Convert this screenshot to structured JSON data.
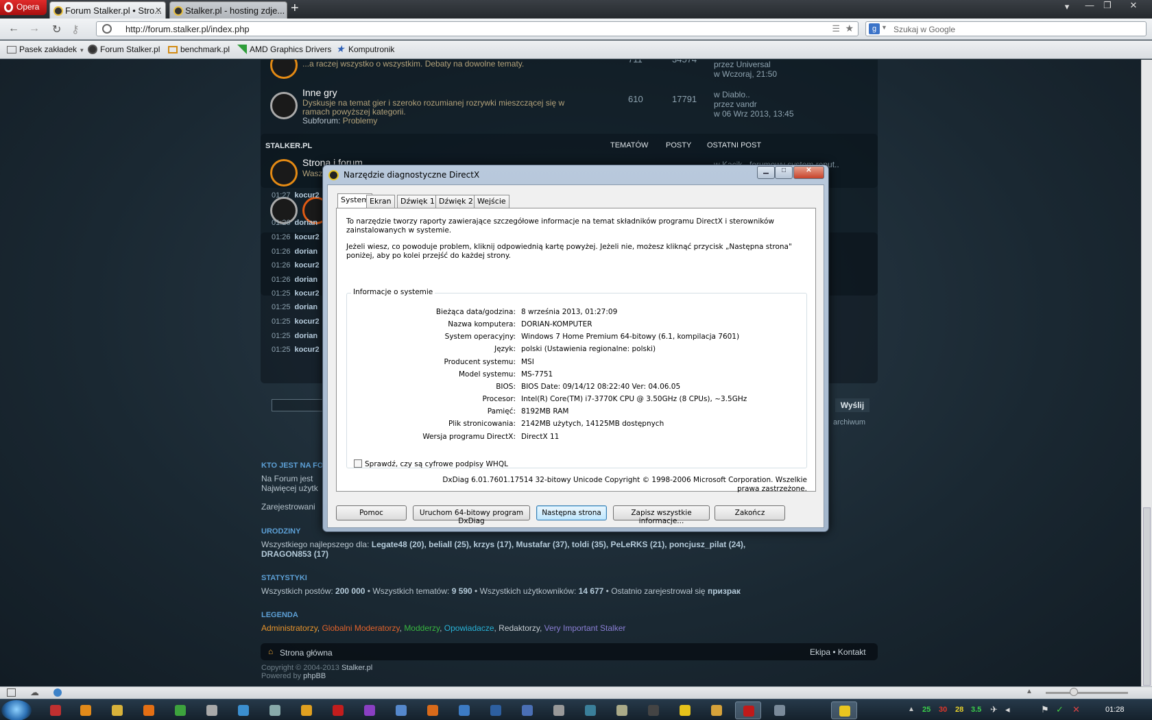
{
  "browser": {
    "menu_label": "Opera",
    "tabs": [
      {
        "label": "Forum Stalker.pl • Stro..."
      },
      {
        "label": "Stalker.pl - hosting zdje..."
      }
    ],
    "url": "http://forum.stalker.pl/index.php",
    "search_placeholder": "Szukaj w Google",
    "bookmarks": [
      "Pasek zakładek",
      "Forum Stalker.pl",
      "benchmark.pl",
      "AMD Graphics Drivers",
      "Komputronik"
    ]
  },
  "forum": {
    "row1": {
      "desc": "...a raczej wszystko o wszystkim. Debaty na dowolne tematy.",
      "topics": "711",
      "posts": "34574",
      "last_by": "przez Universal",
      "last_date": "w Wczoraj, 21:50"
    },
    "row2": {
      "title": "Inne gry",
      "desc1": "Dyskusje na temat gier i szeroko rozumianej rozrywki mieszczącej się w",
      "desc2": "ramach powyższej kategorii.",
      "sub_label": "Subforum:",
      "sub_item": "Problemy",
      "topics": "610",
      "posts": "17791",
      "last_in": "w Diablo..",
      "last_by": "przez vandr",
      "last_date": "w 06 Wrz 2013, 13:45"
    },
    "cat_header": {
      "name": "STALKER.PL",
      "col_topics": "TEMATÓW",
      "col_posts": "POSTY",
      "col_last": "OSTATNI POST"
    },
    "row3": {
      "title": "Strona i forum",
      "desc": "Wasz",
      "last": "w Kącik - forumowy system reput.."
    },
    "shoutbox": {
      "times": [
        "01:27",
        "01:26",
        "01:26",
        "01:26",
        "01:26",
        "01:26",
        "01:25",
        "01:25",
        "01:25",
        "01:25",
        "01:25"
      ],
      "users": [
        "kocur2",
        "dorian",
        "kocur2",
        "dorian",
        "kocur2",
        "dorian",
        "kocur2",
        "dorian",
        "kocur2",
        "dorian",
        "kocur2"
      ],
      "send_label": "Wyślij",
      "archive_label": "archiwum"
    },
    "who_header": "KTO JEST NA FO",
    "who_line1": "Na Forum jest",
    "who_line2": "Najwięcej użytk",
    "who_line3": "Zarejestrowani",
    "birthdays_header": "URODZINY",
    "birthdays_prefix": "Wszystkiego najlepszego dla:",
    "birthdays_line1": "Legate48 (20), beliall (25), krzys (17), Mustafar (37), toldi (35), PeLeRKS (21), poncjusz_pilat (24),",
    "birthdays_line2": "DRAGON853 (17)",
    "stats_header": "STATYSTYKI",
    "stats": {
      "posts_label": "Wszystkich postów:",
      "posts": "200 000",
      "topics_label": "Wszystkich tematów:",
      "topics": "9 590",
      "users_label": "Wszystkich użytkowników:",
      "users": "14 677",
      "newest_label": "Ostatnio zarejestrował się",
      "newest": "призрак"
    },
    "legend_header": "LEGENDA",
    "legend": [
      {
        "label": "Administratorzy",
        "color": "#e8942b"
      },
      {
        "label": "Globalni Moderatorzy",
        "color": "#e3632b"
      },
      {
        "label": "Modderzy",
        "color": "#38b640"
      },
      {
        "label": "Opowiadacze",
        "color": "#29b2d6"
      },
      {
        "label": "Redaktorzy",
        "color": "#c7cdd2"
      },
      {
        "label": "Very Important Stalker",
        "color": "#8b7fd6"
      }
    ],
    "footer": {
      "home": "Strona główna",
      "team": "Ekipa",
      "contact": "Kontakt",
      "copyright": "Copyright © 2004-2013",
      "copyright_site": "Stalker.pl",
      "powered": "Powered by",
      "powered_by": "phpBB"
    }
  },
  "dialog": {
    "title": "Narzędzie diagnostyczne DirectX",
    "tabs": [
      "System",
      "Ekran",
      "Dźwięk 1",
      "Dźwięk 2",
      "Wejście"
    ],
    "intro1": "To narzędzie tworzy raporty zawierające szczegółowe informacje na temat składników programu DirectX i sterowników zainstalowanych w systemie.",
    "intro2": "Jeżeli wiesz, co powoduje problem, kliknij odpowiednią kartę powyżej. Jeżeli nie, możesz kliknąć przycisk „Następna strona\" poniżej, aby po kolei przejść do każdej strony.",
    "group_label": "Informacje o systemie",
    "info": [
      {
        "label": "Bieżąca data/godzina:",
        "value": "8 września 2013, 01:27:09"
      },
      {
        "label": "Nazwa komputera:",
        "value": "DORIAN-KOMPUTER"
      },
      {
        "label": "System operacyjny:",
        "value": "Windows 7 Home Premium 64-bitowy (6.1, kompilacja 7601)"
      },
      {
        "label": "Język:",
        "value": "polski (Ustawienia regionalne: polski)"
      },
      {
        "label": "Producent systemu:",
        "value": "MSI"
      },
      {
        "label": "Model systemu:",
        "value": "MS-7751"
      },
      {
        "label": "BIOS:",
        "value": "BIOS Date: 09/14/12 08:22:40 Ver: 04.06.05"
      },
      {
        "label": "Procesor:",
        "value": "Intel(R) Core(TM) i7-3770K CPU @ 3.50GHz (8 CPUs), ~3.5GHz"
      },
      {
        "label": "Pamięć:",
        "value": "8192MB RAM"
      },
      {
        "label": "Plik stronicowania:",
        "value": "2142MB użytych, 14125MB dostępnych"
      },
      {
        "label": "Wersja programu DirectX:",
        "value": "DirectX 11"
      }
    ],
    "whql_label": "Sprawdź, czy są cyfrowe podpisy WHQL",
    "copyright": "DxDiag 6.01.7601.17514 32-bitowy Unicode  Copyright © 1998-2006 Microsoft Corporation. Wszelkie prawa zastrzeżone.",
    "buttons": {
      "help": "Pomoc",
      "run64": "Uruchom 64-bitowy program DxDiag",
      "next": "Następna strona",
      "save": "Zapisz wszystkie informacje...",
      "exit": "Zakończ"
    }
  },
  "taskbar": {
    "tray_numbers": [
      {
        "v": "25",
        "color": "#3bd24b"
      },
      {
        "v": "30",
        "color": "#e0372b"
      },
      {
        "v": "28",
        "color": "#e8d22b"
      },
      {
        "v": "3.5",
        "color": "#3bd24b"
      }
    ],
    "clock": "01:28"
  }
}
